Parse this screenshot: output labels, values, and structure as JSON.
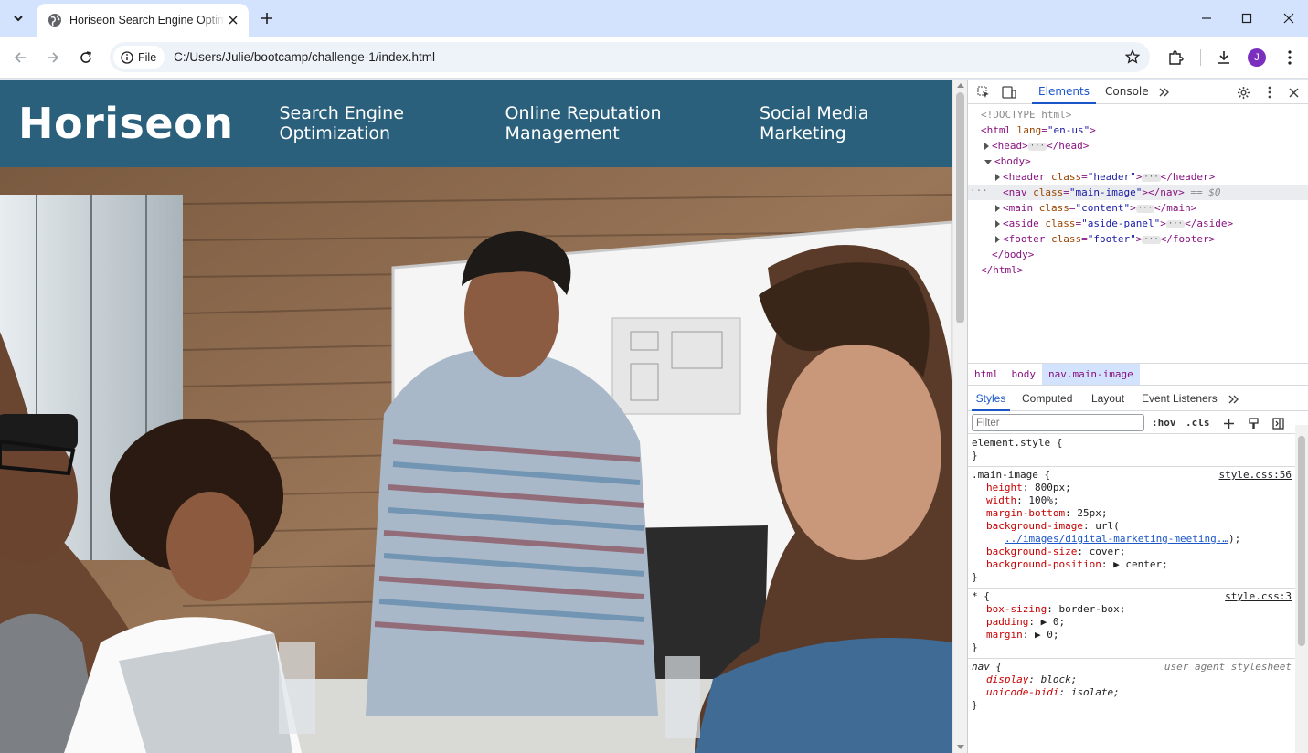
{
  "browser": {
    "tab_title": "Horiseon Search Engine Optimization",
    "url_scheme_label": "File",
    "url": "C:/Users/Julie/bootcamp/challenge-1/index.html",
    "profile_initial": "J"
  },
  "site": {
    "logo": "Horiseon",
    "nav": [
      "Search Engine Optimization",
      "Online Reputation Management",
      "Social Media Marketing"
    ],
    "colors": {
      "header_bg": "#2a607c"
    }
  },
  "devtools": {
    "tabs": {
      "elements": "Elements",
      "console": "Console"
    },
    "dom": {
      "doctype": "<!DOCTYPE html>",
      "html_open_tag": "html",
      "html_attr": "lang",
      "html_val": "\"en-us\"",
      "head": "head",
      "body": "body",
      "children": [
        {
          "tag": "header",
          "attr": "class",
          "val": "\"header\"",
          "collapsed": true
        },
        {
          "tag": "nav",
          "attr": "class",
          "val": "\"main-image\"",
          "collapsed": false,
          "selected": true,
          "suffix": "== $0"
        },
        {
          "tag": "main",
          "attr": "class",
          "val": "\"content\"",
          "collapsed": true
        },
        {
          "tag": "aside",
          "attr": "class",
          "val": "\"aside-panel\"",
          "collapsed": true
        },
        {
          "tag": "footer",
          "attr": "class",
          "val": "\"footer\"",
          "collapsed": true
        }
      ],
      "body_close": "</body>",
      "html_close": "</html>"
    },
    "breadcrumbs": [
      "html",
      "body",
      "nav.main-image"
    ],
    "subtabs": [
      "Styles",
      "Computed",
      "Layout",
      "Event Listeners"
    ],
    "filter_placeholder": "Filter",
    "hov": ":hov",
    "cls": ".cls",
    "rules": [
      {
        "selector": "element.style {",
        "source": "",
        "props": []
      },
      {
        "selector": ".main-image {",
        "source": "style.css:56",
        "props": [
          {
            "name": "height",
            "value": "800px;"
          },
          {
            "name": "width",
            "value": "100%;"
          },
          {
            "name": "margin-bottom",
            "value": "25px;"
          },
          {
            "name": "background-image",
            "value": "url("
          },
          {
            "name": "",
            "value": "../images/digital-marketing-meeting.…",
            "link": true,
            "tail": ");"
          },
          {
            "name": "background-size",
            "value": "cover;"
          },
          {
            "name": "background-position",
            "value": "▶ center;"
          }
        ]
      },
      {
        "selector": "* {",
        "source": "style.css:3",
        "props": [
          {
            "name": "box-sizing",
            "value": "border-box;"
          },
          {
            "name": "padding",
            "value": "▶ 0;"
          },
          {
            "name": "margin",
            "value": "▶ 0;"
          }
        ]
      },
      {
        "selector": "nav {",
        "source": "user agent stylesheet",
        "ua": true,
        "props": [
          {
            "name": "display",
            "value": "block;"
          },
          {
            "name": "unicode-bidi",
            "value": "isolate;"
          }
        ]
      }
    ],
    "close_brace": "}"
  }
}
